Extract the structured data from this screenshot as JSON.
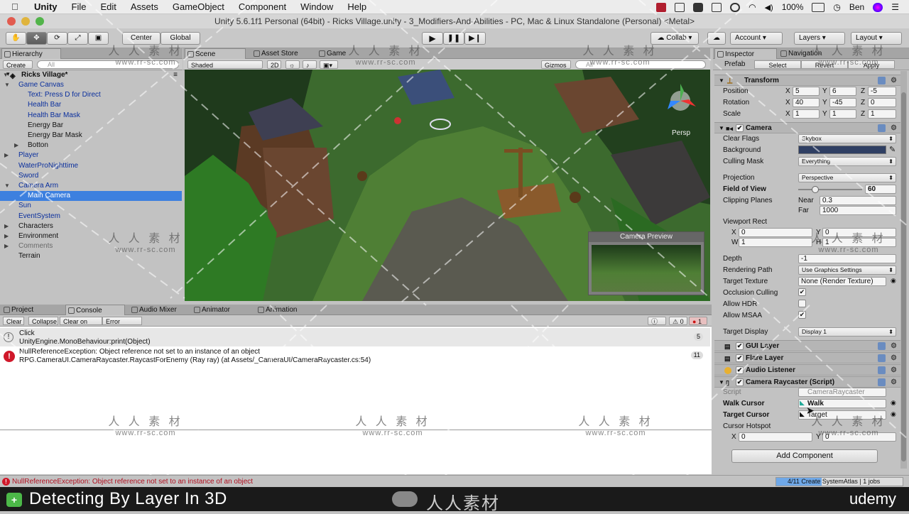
{
  "menubar": {
    "app": "Unity",
    "items": [
      "File",
      "Edit",
      "Assets",
      "GameObject",
      "Component",
      "Window",
      "Help"
    ],
    "battery": "100%",
    "user": "Ben"
  },
  "window_title": "Unity 5.6.1f1 Personal (64bit) - Ricks Village.unity - 3_Modifiers-And-Abilities - PC, Mac & Linux Standalone (Personal) <Metal>",
  "toolbar": {
    "pivot": "Center",
    "space": "Global",
    "collab": "Collab",
    "account": "Account",
    "layers": "Layers",
    "layout": "Layout"
  },
  "hierarchy": {
    "tab": "Hierarchy",
    "create": "Create",
    "search_placeholder": "All",
    "scene_name": "Ricks Village*",
    "items": [
      {
        "label": "Game Canvas",
        "color": "blue"
      },
      {
        "label": "Text: Press D for Direct",
        "color": "blue"
      },
      {
        "label": "Health Bar",
        "color": "blue"
      },
      {
        "label": "Health Bar Mask",
        "color": "blue"
      },
      {
        "label": "Energy Bar",
        "color": "black"
      },
      {
        "label": "Energy Bar Mask",
        "color": "black"
      },
      {
        "label": "Botton",
        "color": "black"
      },
      {
        "label": "Player",
        "color": "blue"
      },
      {
        "label": "WaterProNighttime",
        "color": "blue"
      },
      {
        "label": "Sword",
        "color": "blue"
      },
      {
        "label": "Camera Arm",
        "color": "blue"
      },
      {
        "label": "Main Camera",
        "color": "selected"
      },
      {
        "label": "Sun",
        "color": "blue"
      },
      {
        "label": "EventSystem",
        "color": "blue"
      },
      {
        "label": "Characters",
        "color": "black"
      },
      {
        "label": "Environment",
        "color": "black"
      },
      {
        "label": "Comments",
        "color": "gray"
      },
      {
        "label": "Terrain",
        "color": "black"
      }
    ]
  },
  "scene": {
    "tabs": [
      "Scene",
      "Asset Store",
      "Game"
    ],
    "shading": "Shaded",
    "mode_2d": "2D",
    "gizmos": "Gizmos",
    "search_placeholder": "All",
    "persp": "Persp",
    "camera_preview": "Camera Preview"
  },
  "console": {
    "tabs": [
      "Project",
      "Console",
      "Audio Mixer",
      "Animator",
      "Animation"
    ],
    "buttons": [
      "Clear",
      "Collapse",
      "Clear on Play",
      "Error Pause"
    ],
    "counts": {
      "info": "1",
      "warn": "0",
      "error": "1"
    },
    "entries": [
      {
        "line1": "Click",
        "line2": "UnityEngine.MonoBehaviour:print(Object)",
        "count": "5"
      },
      {
        "line1": "NullReferenceException: Object reference not set to an instance of an object",
        "line2": "RPG.CameraUI.CameraRaycaster.RaycastForEnemy (Ray ray) (at Assets/_CameraUI/CameraRaycaster.cs:54)",
        "count": "11"
      }
    ]
  },
  "inspector": {
    "tabs": [
      "Inspector",
      "Navigation"
    ],
    "prefab": "Prefab",
    "prefab_buttons": [
      "Select",
      "Revert",
      "Apply"
    ],
    "transform": {
      "title": "Transform",
      "rows": [
        {
          "label": "Position",
          "x": "5",
          "y": "6",
          "z": "-5"
        },
        {
          "label": "Rotation",
          "x": "40",
          "y": "-45",
          "z": "0"
        },
        {
          "label": "Scale",
          "x": "1",
          "y": "1",
          "z": "1"
        }
      ]
    },
    "camera": {
      "title": "Camera",
      "clear_flags": "Clear Flags",
      "clear_flags_value": "Skybox",
      "background": "Background",
      "background_color": "#2f3f63",
      "culling_mask": "Culling Mask",
      "culling_mask_value": "Everything",
      "projection": "Projection",
      "projection_value": "Perspective",
      "fov": "Field of View",
      "fov_value": "60",
      "fov_fraction": 0.27,
      "clipping": "Clipping Planes",
      "near": "Near",
      "near_value": "0.3",
      "far": "Far",
      "far_value": "1000",
      "viewport": "Viewport Rect",
      "vx": "0",
      "vy": "0",
      "vw": "1",
      "vh": "1",
      "depth": "Depth",
      "depth_value": "-1",
      "rendering_path": "Rendering Path",
      "rendering_path_value": "Use Graphics Settings",
      "target_texture": "Target Texture",
      "target_texture_value": "None (Render Texture)",
      "occlusion": "Occlusion Culling",
      "hdr": "Allow HDR",
      "msaa": "Allow MSAA",
      "target_display": "Target Display",
      "target_display_value": "Display 1"
    },
    "components": [
      "GUI Layer",
      "Flare Layer",
      "Audio Listener",
      "Camera Raycaster (Script)"
    ],
    "raycaster": {
      "script": "Script",
      "script_value": "CameraRaycaster",
      "walk": "Walk Cursor",
      "walk_value": "Walk",
      "target": "Target Cursor",
      "target_value": "Target",
      "hotspot": "Cursor Hotspot",
      "hx": "0",
      "hy": "0"
    },
    "add_component": "Add Component"
  },
  "status": {
    "error": "NullReferenceException: Object reference not set to an instance of an object",
    "progress": "4/11 Create SystemAtlas | 1 jobs",
    "progress_fraction": 0.36
  },
  "caption": {
    "title": "Detecting By Layer In 3D",
    "brand": "udemy"
  },
  "watermark": {
    "cn": "人 人 素 材",
    "url": "www.rr-sc.com",
    "logo": "人人素材"
  }
}
